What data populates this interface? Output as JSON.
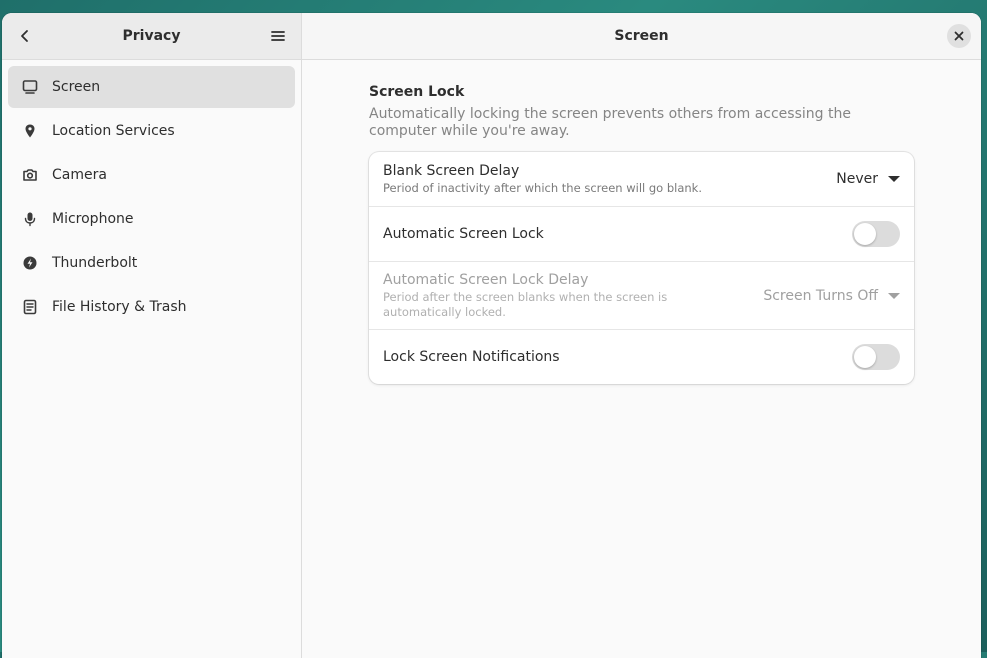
{
  "sidebar": {
    "title": "Privacy",
    "items": [
      {
        "label": "Screen",
        "icon": "monitor-icon"
      },
      {
        "label": "Location Services",
        "icon": "location-pin-icon"
      },
      {
        "label": "Camera",
        "icon": "camera-icon"
      },
      {
        "label": "Microphone",
        "icon": "microphone-icon"
      },
      {
        "label": "Thunderbolt",
        "icon": "thunderbolt-icon"
      },
      {
        "label": "File History & Trash",
        "icon": "file-history-icon"
      }
    ],
    "selected_index": 0
  },
  "content": {
    "title": "Screen",
    "section": {
      "title": "Screen Lock",
      "description": "Automatically locking the screen prevents others from accessing the computer while you're away.",
      "rows": [
        {
          "label": "Blank Screen Delay",
          "subtitle": "Period of inactivity after which the screen will go blank.",
          "value": "Never"
        },
        {
          "label": "Automatic Screen Lock",
          "switch_on": false
        },
        {
          "label": "Automatic Screen Lock Delay",
          "subtitle": "Period after the screen blanks when the screen is automatically locked.",
          "value": "Screen Turns Off",
          "disabled": true
        },
        {
          "label": "Lock Screen Notifications",
          "switch_on": false
        }
      ]
    }
  },
  "colors": {
    "sidebar_bg": "#ebebeb",
    "selected_bg": "#e0e0e0",
    "window_bg": "#fafafa",
    "switch_off": "#dcdcdc"
  }
}
